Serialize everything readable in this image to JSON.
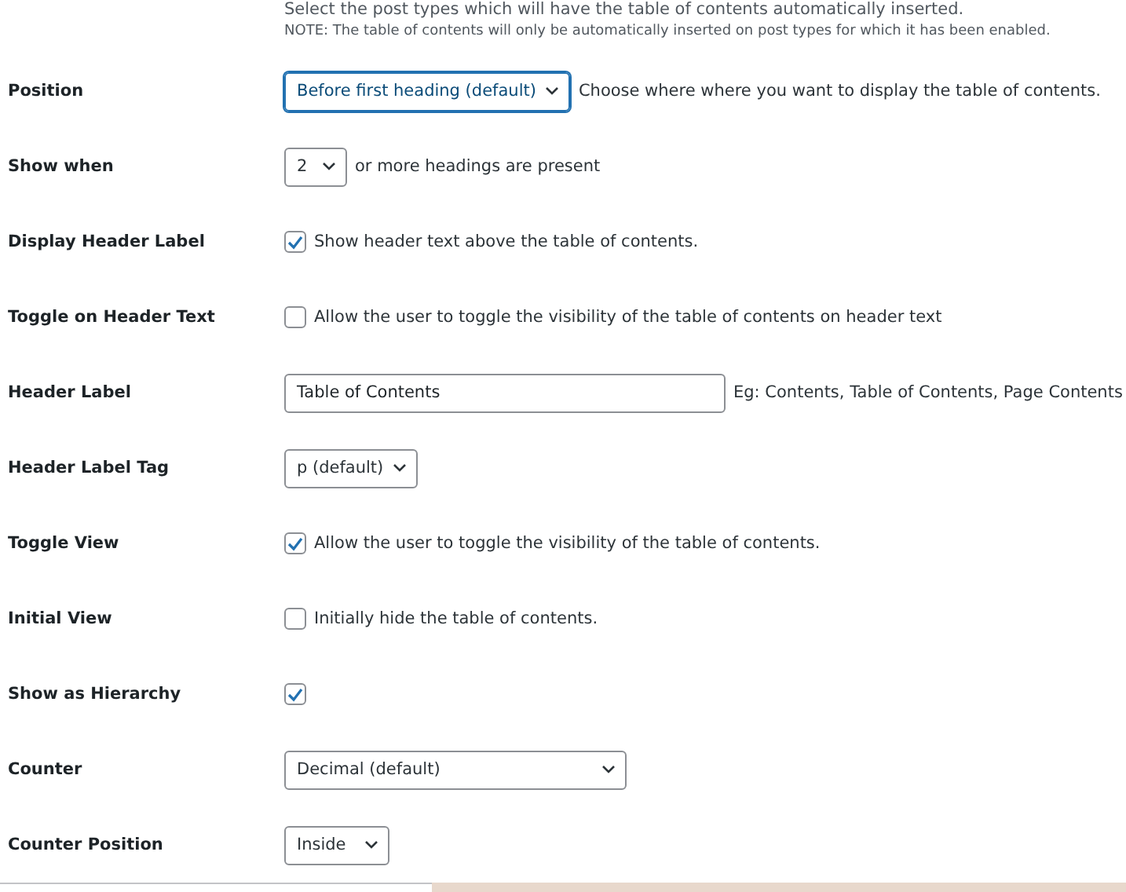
{
  "intro": {
    "description": "Select the post types which will have the table of contents automatically inserted.",
    "note": "NOTE: The table of contents will only be automatically inserted on post types for which it has been enabled."
  },
  "settings": [
    {
      "label": "Position",
      "kind": "select",
      "value": "Before first heading (default)",
      "focused": true,
      "description": "Choose where where you want to display the table of contents."
    },
    {
      "label": "Show when",
      "kind": "select",
      "value": "2",
      "focused": false,
      "description": "or more headings are present"
    },
    {
      "label": "Display Header Label",
      "kind": "checkbox",
      "checked": true,
      "description": "Show header text above the table of contents."
    },
    {
      "label": "Toggle on Header Text",
      "kind": "checkbox",
      "checked": false,
      "description": "Allow the user to toggle the visibility of the table of contents on header text"
    },
    {
      "label": "Header Label",
      "kind": "text",
      "value": "Table of Contents",
      "description": "Eg: Contents, Table of Contents, Page Contents"
    },
    {
      "label": "Header Label Tag",
      "kind": "select",
      "value": "p (default)",
      "focused": false
    },
    {
      "label": "Toggle View",
      "kind": "checkbox",
      "checked": true,
      "description": "Allow the user to toggle the visibility of the table of contents."
    },
    {
      "label": "Initial View",
      "kind": "checkbox",
      "checked": false,
      "description": "Initially hide the table of contents."
    },
    {
      "label": "Show as Hierarchy",
      "kind": "checkbox",
      "checked": true
    },
    {
      "label": "Counter",
      "kind": "select",
      "value": "Decimal (default)",
      "focused": false
    },
    {
      "label": "Counter Position",
      "kind": "select",
      "value": "Inside",
      "focused": false
    }
  ]
}
